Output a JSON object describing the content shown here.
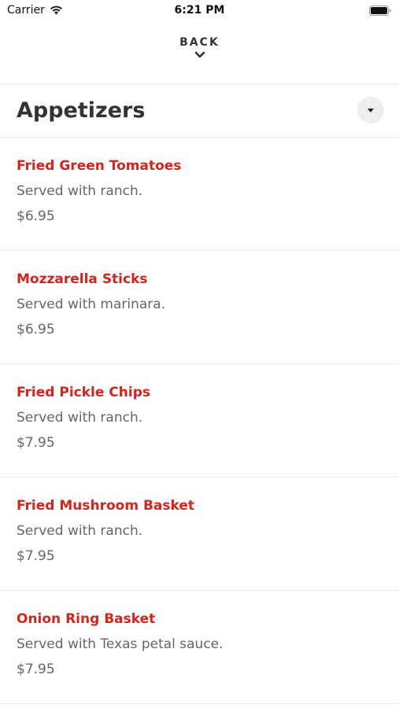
{
  "status_bar": {
    "carrier": "Carrier",
    "time": "6:21 PM"
  },
  "nav": {
    "back_label": "BACK"
  },
  "section": {
    "title": "Appetizers"
  },
  "items": [
    {
      "name": "Fried Green Tomatoes",
      "description": "Served with ranch.",
      "price": "$6.95"
    },
    {
      "name": "Mozzarella Sticks",
      "description": "Served with marinara.",
      "price": "$6.95"
    },
    {
      "name": "Fried Pickle Chips",
      "description": "Served with ranch.",
      "price": "$7.95"
    },
    {
      "name": "Fried Mushroom Basket",
      "description": "Served with ranch.",
      "price": "$7.95"
    },
    {
      "name": "Onion Ring Basket",
      "description": "Served with Texas petal sauce.",
      "price": "$7.95"
    }
  ],
  "colors": {
    "item_name": "#d7231a",
    "text_muted": "#666666",
    "divider": "#e8e8e8"
  }
}
